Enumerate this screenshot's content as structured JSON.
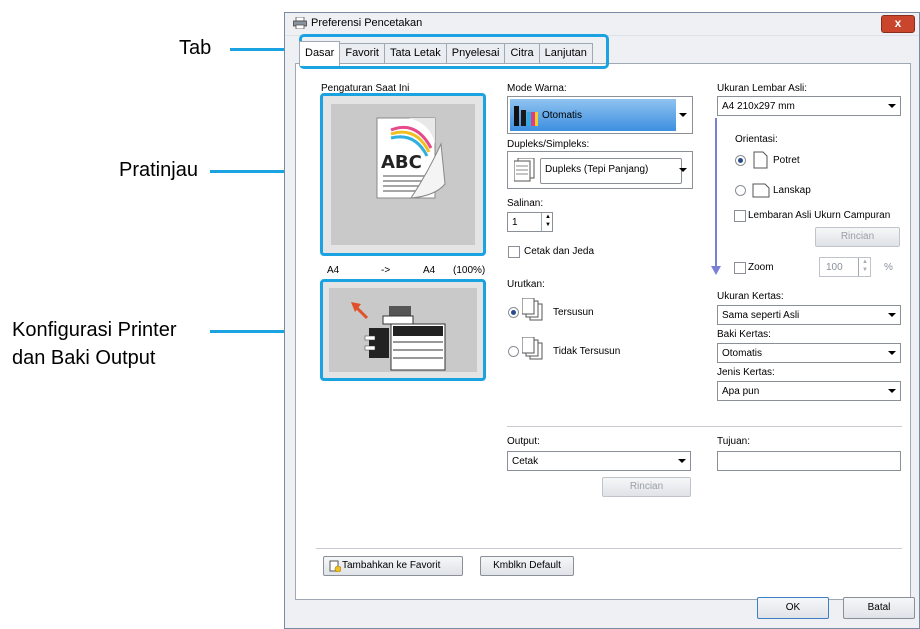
{
  "callouts": {
    "tab": "Tab",
    "preview": "Pratinjau",
    "printer_line1": "Konfigurasi Printer",
    "printer_line2": "dan Baki Output"
  },
  "window": {
    "title": "Preferensi Pencetakan",
    "close": "x"
  },
  "tabs": [
    "Dasar",
    "Favorit",
    "Tata Letak",
    "Pnyelesai",
    "Citra",
    "Lanjutan"
  ],
  "left": {
    "current_settings_label": "Pengaturan Saat Ini",
    "preview_page_text": "ABC",
    "size_from": "A4",
    "size_arrow": "->",
    "size_to": "A4",
    "size_percent": "(100%)"
  },
  "middle": {
    "color_mode_label": "Mode Warna:",
    "color_mode_value": "Otomatis",
    "duplex_label": "Dupleks/Simpleks:",
    "duplex_value": "Dupleks (Tepi Panjang)",
    "copies_label": "Salinan:",
    "copies_value": "1",
    "print_pause_label": "Cetak dan Jeda",
    "sort_label": "Urutkan:",
    "sort_collated": "Tersusun",
    "sort_uncollated": "Tidak Tersusun"
  },
  "right": {
    "orig_size_label": "Ukuran Lembar Asli:",
    "orig_size_value": "A4 210x297 mm",
    "orientation_label": "Orientasi:",
    "portrait": "Potret",
    "landscape": "Lanskap",
    "mixed_label": "Lembaran Asli Ukurn Campuran",
    "details": "Rincian",
    "zoom_label": "Zoom",
    "zoom_value": "100",
    "zoom_unit": "%",
    "paper_size_label": "Ukuran Kertas:",
    "paper_size_value": "Sama seperti Asli",
    "tray_label": "Baki Kertas:",
    "tray_value": "Otomatis",
    "paper_type_label": "Jenis Kertas:",
    "paper_type_value": "Apa pun"
  },
  "output": {
    "label": "Output:",
    "value": "Cetak",
    "details": "Rincian",
    "dest_label": "Tujuan:",
    "dest_value": ""
  },
  "bottom": {
    "add_favorite": "Tambahkan ke Favorit",
    "restore_default": "Kmblkn Default",
    "ok": "OK",
    "cancel": "Batal"
  },
  "colors": {
    "accent": "#1aa3e0",
    "selection_blue": "#3d8fe0"
  }
}
